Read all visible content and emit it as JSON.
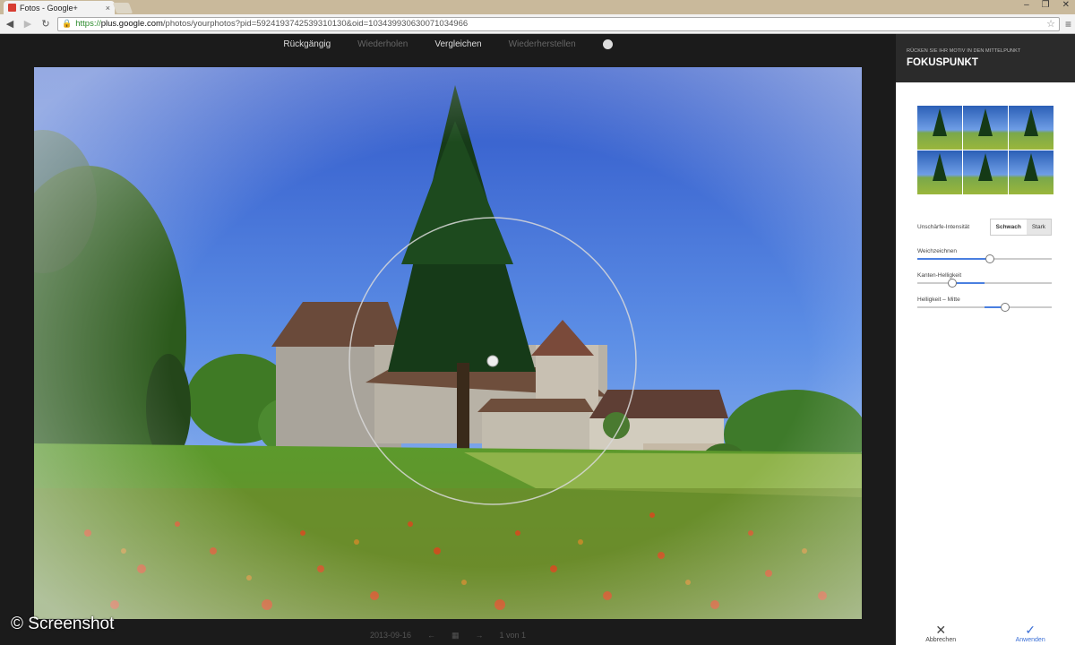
{
  "browser": {
    "tab_title": "Fotos - Google+",
    "tab_close": "×",
    "url_scheme": "https://",
    "url_host": "plus.google.com",
    "url_path": "/photos/yourphotos?pid=5924193742539310130&oid=103439930630071034966",
    "window_buttons": [
      "–",
      "❐",
      "✕"
    ]
  },
  "editor": {
    "undo_label": "Rückgängig",
    "redo_label": "Wiederholen",
    "compare_label": "Vergleichen",
    "restore_label": "Wiederherstellen",
    "help_label": "?",
    "date": "2013-09-16",
    "page_count": "1 von 1"
  },
  "panel": {
    "subtitle": "RÜCKEN SIE IHR MOTIV IN DEN MITTELPUNKT",
    "title": "FOKUSPUNKT",
    "intensity_label": "Unschärfe-Intensität",
    "intensity_options": [
      "Schwach",
      "Stark"
    ],
    "intensity_selected": "Schwach",
    "sliders": [
      {
        "label": "Weichzeichnen",
        "value": 0.54
      },
      {
        "label": "Kanten-Helligkeit",
        "value": 0.26,
        "fill_to": 0.5
      },
      {
        "label": "Helligkeit – Mitte",
        "value": 0.65,
        "fill_from": 0.5
      }
    ],
    "cancel_label": "Abbrechen",
    "apply_label": "Anwenden"
  },
  "watermark": "© Screenshot",
  "colors": {
    "accent": "#3b6fd6",
    "background": "#1b1b1b",
    "panel_header": "#2b2b2b"
  }
}
